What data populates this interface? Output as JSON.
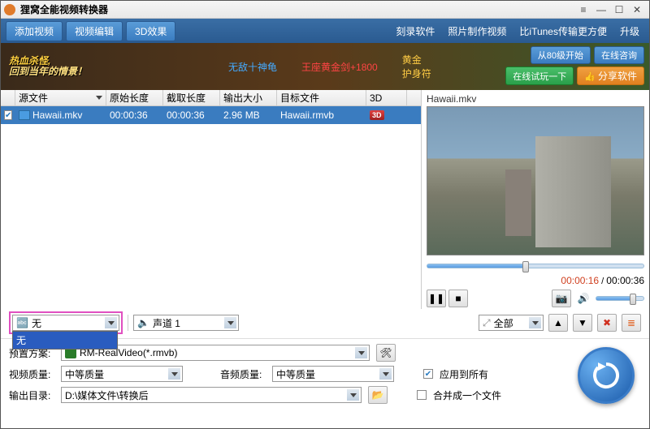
{
  "window": {
    "title": "狸窝全能视频转换器"
  },
  "toolbar": {
    "add_video": "添加视频",
    "video_edit": "视频编辑",
    "effect_3d": "3D效果",
    "burn": "刻录软件",
    "photo_video": "照片制作视频",
    "itunes": "比iTunes传输更方便",
    "upgrade": "升级"
  },
  "banner": {
    "line1": "热血杀怪,",
    "line2": "回到当年的情景！",
    "tag1": "无敌十神龟",
    "tag2": "王座黄金剑+1800",
    "tag3": "黄金",
    "tag4": "护身符",
    "btn_start80": "从80级开始",
    "btn_tryonline": "在线试玩一下",
    "btn_consult": "在线咨询",
    "btn_share": "分享软件"
  },
  "grid": {
    "headers": {
      "source": "源文件",
      "orig_len": "原始长度",
      "cut_len": "截取长度",
      "out_size": "输出大小",
      "target": "目标文件",
      "threed": "3D"
    },
    "rows": [
      {
        "checked": true,
        "source": "Hawaii.mkv",
        "orig_len": "00:00:36",
        "cut_len": "00:00:36",
        "out_size": "2.96 MB",
        "target": "Hawaii.rmvb",
        "threed": "3D"
      }
    ]
  },
  "preview": {
    "filename": "Hawaii.mkv",
    "time_current": "00:00:16",
    "time_total": "00:00:36"
  },
  "subtitle": {
    "label_icon": "≡",
    "selected": "无",
    "option_none": "无",
    "audio_label": "声道 1",
    "all_label": "全部"
  },
  "settings": {
    "preset_label": "预置方案:",
    "preset_value": "RM-RealVideo(*.rmvb)",
    "vq_label": "视频质量:",
    "vq_value": "中等质量",
    "aq_label": "音频质量:",
    "aq_value": "中等质量",
    "apply_all": "应用到所有",
    "out_label": "输出目录:",
    "out_value": "D:\\媒体文件\\转换后",
    "merge": "合并成一个文件"
  }
}
